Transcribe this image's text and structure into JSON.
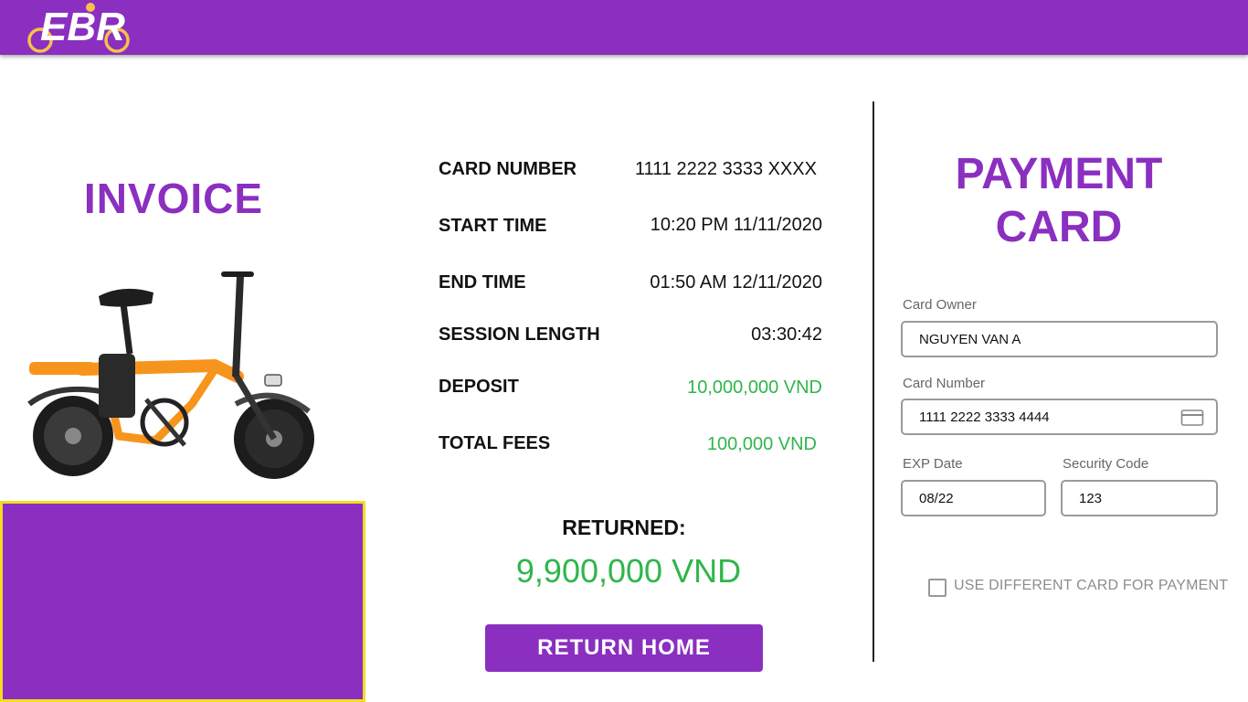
{
  "header": {
    "logo_text": "EBR"
  },
  "invoice": {
    "title": "INVOICE",
    "rows": [
      {
        "label": "CARD NUMBER",
        "value": "1111 2222 3333 XXXX"
      },
      {
        "label": "START TIME",
        "value": "10:20 PM 11/11/2020"
      },
      {
        "label": "END TIME",
        "value": "01:50 AM 12/11/2020"
      },
      {
        "label": "SESSION LENGTH",
        "value": "03:30:42"
      },
      {
        "label": "DEPOSIT",
        "value": "10,000,000 VND"
      },
      {
        "label": "TOTAL FEES",
        "value": "100,000 VND"
      }
    ],
    "returned_label": "RETURNED:",
    "returned_amount": "9,900,000 VND",
    "return_button": "RETURN HOME"
  },
  "payment": {
    "title_line1": "PAYMENT",
    "title_line2": "CARD",
    "card_owner_label": "Card Owner",
    "card_owner_value": "NGUYEN VAN A",
    "card_number_label": "Card Number",
    "card_number_value": "1111 2222 3333 4444",
    "exp_label": "EXP Date",
    "exp_value": "08/22",
    "security_label": "Security Code",
    "security_value": "123",
    "different_card_label": "USE DIFFERENT CARD FOR PAYMENT",
    "different_card_checked": false
  },
  "colors": {
    "brand_purple": "#8a2fc0",
    "money_green": "#2fb64b",
    "promo_border_yellow": "#f2dd22",
    "logo_accent": "#f7c04a"
  },
  "icons": [
    "ebr-bicycle-logo-icon",
    "credit-card-icon",
    "electric-bike-image"
  ]
}
